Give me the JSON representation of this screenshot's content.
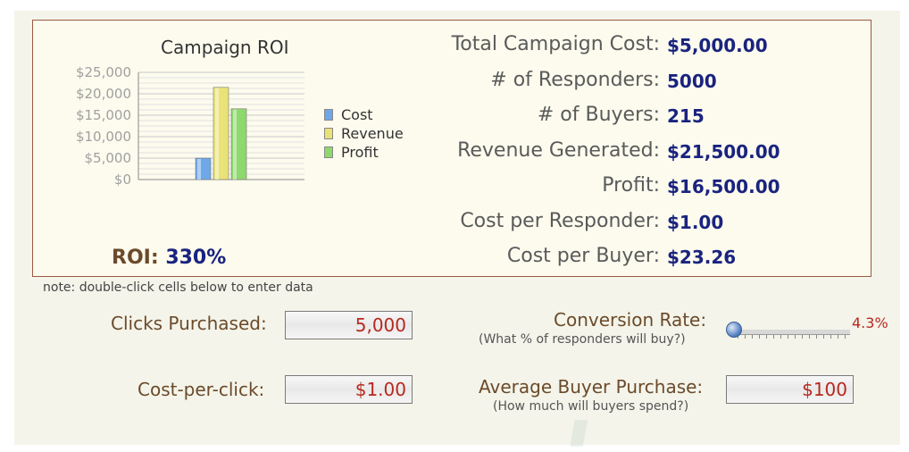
{
  "chart": {
    "title": "Campaign ROI",
    "legend": [
      {
        "label": "Cost",
        "color": "#6fa8e8"
      },
      {
        "label": "Revenue",
        "color": "#e9e277"
      },
      {
        "label": "Profit",
        "color": "#8ed86e"
      }
    ]
  },
  "chart_data": {
    "type": "bar",
    "title": "Campaign ROI",
    "categories": [
      "Cost",
      "Revenue",
      "Profit"
    ],
    "values": [
      5000,
      21500,
      16500
    ],
    "ylim": [
      0,
      25000
    ],
    "yticks": [
      "$25,000",
      "$20,000",
      "$15,000",
      "$10,000",
      "$5,000",
      "$0"
    ],
    "grid": true,
    "legend_position": "right",
    "colors": [
      "#6fa8e8",
      "#e9e277",
      "#8ed86e"
    ]
  },
  "roi": {
    "label": "ROI:",
    "value": "330%"
  },
  "stats": [
    {
      "label": "Total Campaign Cost:",
      "value": "$5,000.00"
    },
    {
      "label": "# of Responders:",
      "value": "5000"
    },
    {
      "label": "# of Buyers:",
      "value": "215"
    },
    {
      "label": "Revenue Generated:",
      "value": "$21,500.00"
    },
    {
      "label": "Profit:",
      "value": "$16,500.00"
    },
    {
      "label": "Cost per Responder:",
      "value": "$1.00"
    },
    {
      "label": "Cost per Buyer:",
      "value": "$23.26"
    }
  ],
  "note": "note: double-click cells below to enter data",
  "inputs": {
    "clicks": {
      "label": "Clicks Purchased:",
      "value": "5,000"
    },
    "cpc": {
      "label": "Cost-per-click:",
      "value": "$1.00"
    },
    "conversion": {
      "label": "Conversion Rate:",
      "hint": "(What % of responders will buy?)",
      "value": "4.3%",
      "level": 0.0
    },
    "purchase": {
      "label": "Average Buyer Purchase:",
      "hint": "(How much will buyers spend?)",
      "value": "$100"
    }
  }
}
